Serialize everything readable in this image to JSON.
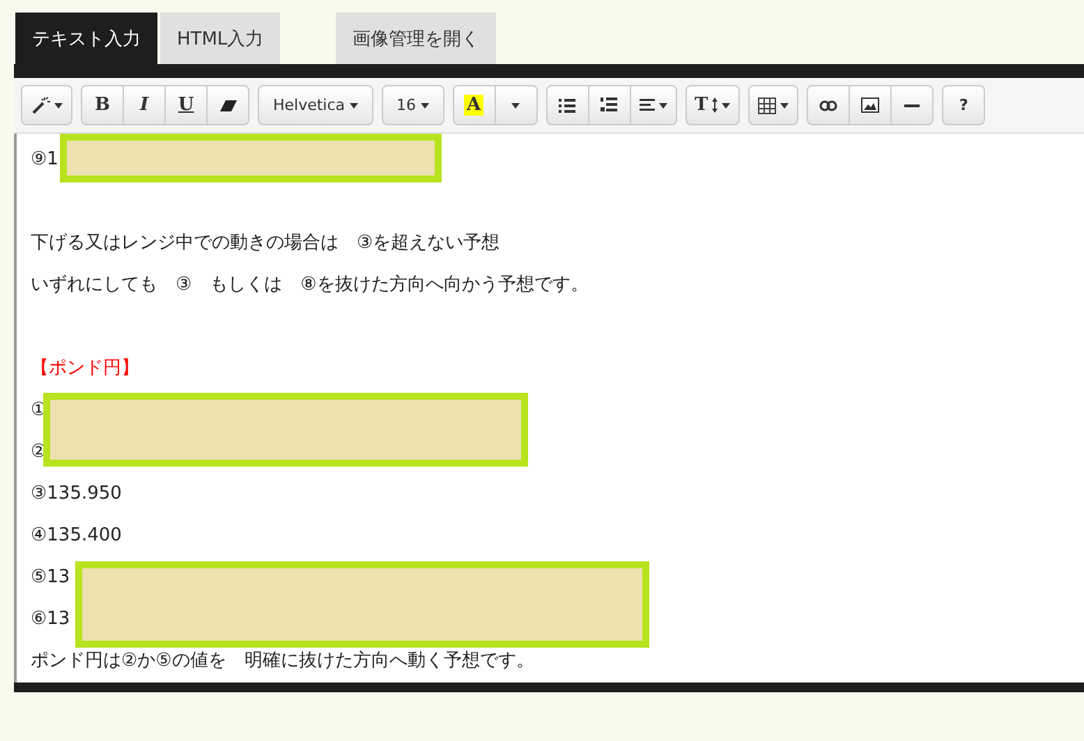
{
  "tabs": [
    {
      "label": "テキスト入力",
      "selected": true
    },
    {
      "label": "HTML入力",
      "selected": false
    }
  ],
  "image_manager_button": "画像管理を開く",
  "toolbar": {
    "groups": [
      [
        {
          "kind": "wand",
          "dropdown": true
        }
      ],
      [
        {
          "kind": "bold",
          "label": "B"
        },
        {
          "kind": "italic",
          "label": "I"
        },
        {
          "kind": "underline",
          "label": "U"
        },
        {
          "kind": "eraser"
        }
      ],
      [
        {
          "kind": "font",
          "label": "Helvetica",
          "dropdown": true
        }
      ],
      [
        {
          "kind": "size",
          "label": "16",
          "dropdown": true
        }
      ],
      [
        {
          "kind": "color",
          "label": "A"
        },
        {
          "kind": "caret",
          "dropdown": true
        }
      ],
      [
        {
          "kind": "ul"
        },
        {
          "kind": "ol"
        },
        {
          "kind": "align",
          "dropdown": true
        }
      ],
      [
        {
          "kind": "height",
          "label": "T",
          "dropdown": true
        }
      ],
      [
        {
          "kind": "table",
          "dropdown": true
        }
      ],
      [
        {
          "kind": "link"
        },
        {
          "kind": "image"
        },
        {
          "kind": "hr"
        }
      ],
      [
        {
          "kind": "help",
          "label": "?"
        }
      ]
    ]
  },
  "content": [
    {
      "kind": "text",
      "text": "⑨1"
    },
    {
      "kind": "blank"
    },
    {
      "kind": "text",
      "text": "下げる又はレンジ中での動きの場合は　③を超えない予想"
    },
    {
      "kind": "text",
      "text": "いずれにしても　③　もしくは　⑧を抜けた方向へ向かう予想です。"
    },
    {
      "kind": "blank"
    },
    {
      "kind": "heading",
      "text": "【ポンド円】"
    },
    {
      "kind": "text",
      "text": "①"
    },
    {
      "kind": "text",
      "text": "②"
    },
    {
      "kind": "text",
      "text": "③135.950"
    },
    {
      "kind": "text",
      "text": "④135.400"
    },
    {
      "kind": "text",
      "text": "⑤13"
    },
    {
      "kind": "text",
      "text": "⑥13"
    },
    {
      "kind": "text",
      "text": "ポンド円は②か⑤の値を　明確に抜けた方向へ動く予想です。"
    }
  ]
}
